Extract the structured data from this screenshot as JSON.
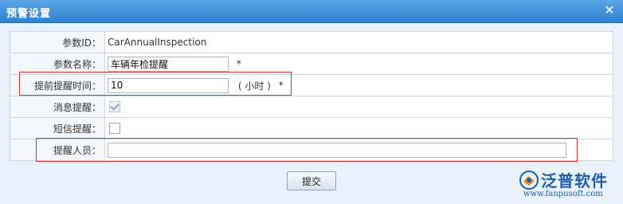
{
  "dialog": {
    "title": "预警设置",
    "close_icon": "close-icon"
  },
  "form": {
    "param_id": {
      "label": "参数ID：",
      "value": "CarAnnualInspection"
    },
    "param_name": {
      "label": "参数名称：",
      "value": "车辆年检提醒",
      "required": "*"
    },
    "advance_time": {
      "label": "提前提醒时间：",
      "value": "10",
      "unit": "( 小时 )",
      "required": "*"
    },
    "message_reminder": {
      "label": "消息提醒：",
      "checked": true,
      "disabled": true
    },
    "sms_reminder": {
      "label": "短信提醒：",
      "checked": false
    },
    "reminder_people": {
      "label": "提醒人员：",
      "value": ""
    }
  },
  "actions": {
    "submit_label": "提交"
  },
  "logo": {
    "name": "泛普软件",
    "url": "www.fanpusoft.com"
  }
}
